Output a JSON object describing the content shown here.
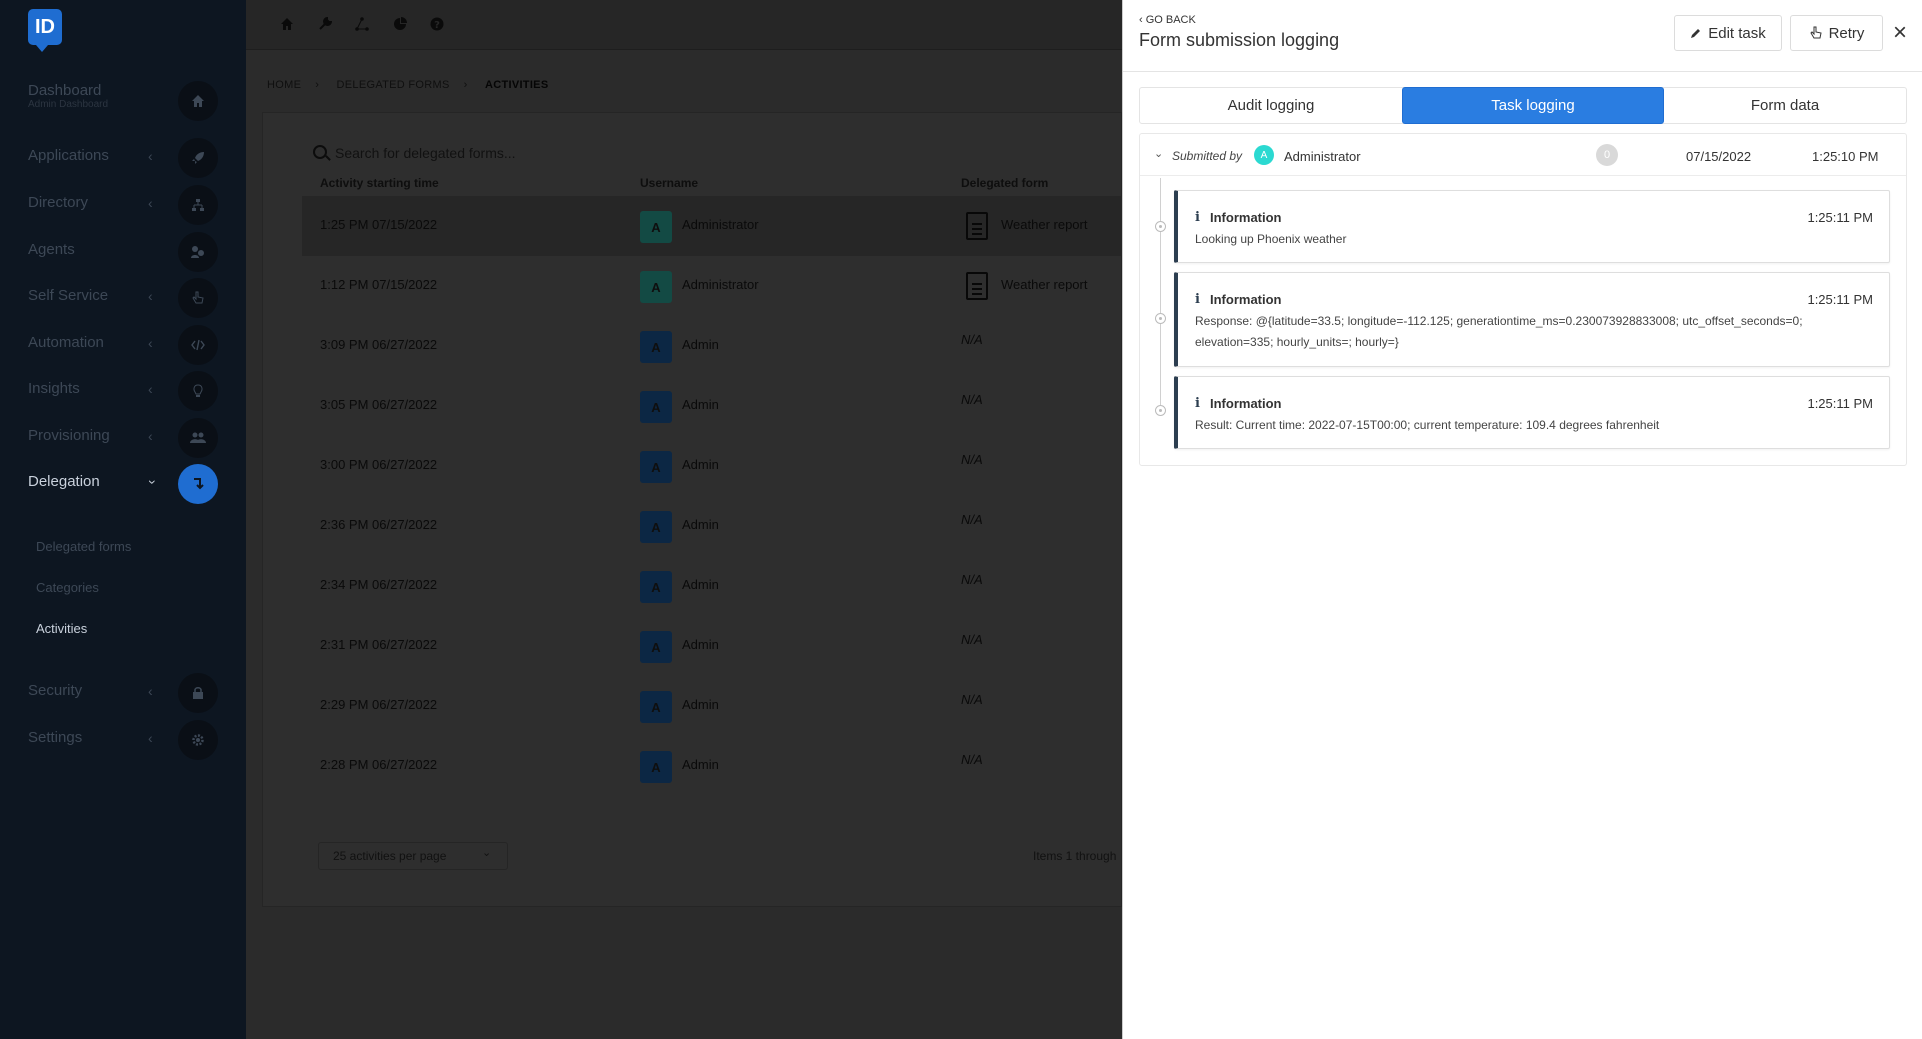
{
  "sidebar": {
    "logo": "ID",
    "items": [
      {
        "label": "Dashboard",
        "sub": "Admin Dashboard",
        "icon": "home-icon",
        "has_chevron": false
      },
      {
        "label": "Applications",
        "icon": "rocket-icon",
        "has_chevron": true
      },
      {
        "label": "Directory",
        "icon": "hierarchy-icon",
        "has_chevron": true
      },
      {
        "label": "Agents",
        "icon": "agents-icon",
        "has_chevron": false
      },
      {
        "label": "Self Service",
        "icon": "hand-pointer-icon",
        "has_chevron": true
      },
      {
        "label": "Automation",
        "icon": "code-icon",
        "has_chevron": true
      },
      {
        "label": "Insights",
        "icon": "lightbulb-icon",
        "has_chevron": true
      },
      {
        "label": "Provisioning",
        "icon": "users-icon",
        "has_chevron": true
      },
      {
        "label": "Delegation",
        "icon": "delegation-icon",
        "has_chevron": true,
        "active": true
      },
      {
        "label": "Security",
        "icon": "lock-icon",
        "has_chevron": true
      },
      {
        "label": "Settings",
        "icon": "gear-icon",
        "has_chevron": true
      }
    ],
    "delegation_sub": [
      "Delegated forms",
      "Categories",
      "Activities"
    ]
  },
  "breadcrumb": [
    "HOME",
    "DELEGATED FORMS",
    "ACTIVITIES"
  ],
  "search": {
    "placeholder": "Search for delegated forms..."
  },
  "table": {
    "columns": [
      "Activity starting time",
      "Username",
      "Delegated form"
    ],
    "rows": [
      {
        "time": "1:25 PM 07/15/2022",
        "avatar": "A",
        "user": "Administrator",
        "form": "Weather report"
      },
      {
        "time": "1:12 PM 07/15/2022",
        "avatar": "A",
        "user": "Administrator",
        "form": "Weather report"
      },
      {
        "time": "3:09 PM 06/27/2022",
        "avatar": "A",
        "user": "Admin",
        "form": "N/A"
      },
      {
        "time": "3:05 PM 06/27/2022",
        "avatar": "A",
        "user": "Admin",
        "form": "N/A"
      },
      {
        "time": "3:00 PM 06/27/2022",
        "avatar": "A",
        "user": "Admin",
        "form": "N/A"
      },
      {
        "time": "2:36 PM 06/27/2022",
        "avatar": "A",
        "user": "Admin",
        "form": "N/A"
      },
      {
        "time": "2:34 PM 06/27/2022",
        "avatar": "A",
        "user": "Admin",
        "form": "N/A"
      },
      {
        "time": "2:31 PM 06/27/2022",
        "avatar": "A",
        "user": "Admin",
        "form": "N/A"
      },
      {
        "time": "2:29 PM 06/27/2022",
        "avatar": "A",
        "user": "Admin",
        "form": "N/A"
      },
      {
        "time": "2:28 PM 06/27/2022",
        "avatar": "A",
        "user": "Admin",
        "form": "N/A"
      }
    ],
    "per_page": "25 activities per page",
    "items_info": "Items 1 through"
  },
  "panel": {
    "go_back": "‹ GO BACK",
    "title": "Form submission logging",
    "edit_label": "Edit task",
    "retry_label": "Retry",
    "tabs": [
      "Audit logging",
      "Task logging",
      "Form data"
    ],
    "active_tab": "Task logging",
    "submission": {
      "submitted_by_label": "Submitted by",
      "avatar": "A",
      "user": "Administrator",
      "count": "0",
      "date": "07/15/2022",
      "time": "1:25:10 PM"
    },
    "entries": [
      {
        "type": "Information",
        "time": "1:25:11 PM",
        "message": "Looking up Phoenix weather"
      },
      {
        "type": "Information",
        "time": "1:25:11 PM",
        "message": "Response: @{latitude=33.5; longitude=-112.125; generationtime_ms=0.230073928833008; utc_offset_seconds=0; elevation=335; hourly_units=; hourly=}"
      },
      {
        "type": "Information",
        "time": "1:25:11 PM",
        "message": "Result: Current time: 2022-07-15T00:00; current temperature: 109.4 degrees fahrenheit"
      }
    ]
  },
  "colors": {
    "accent": "#2a7de1",
    "sidebar_bg": "#0d1621",
    "overlay": "#2b2b2b",
    "teal_avatar": "#2bd9d1"
  }
}
